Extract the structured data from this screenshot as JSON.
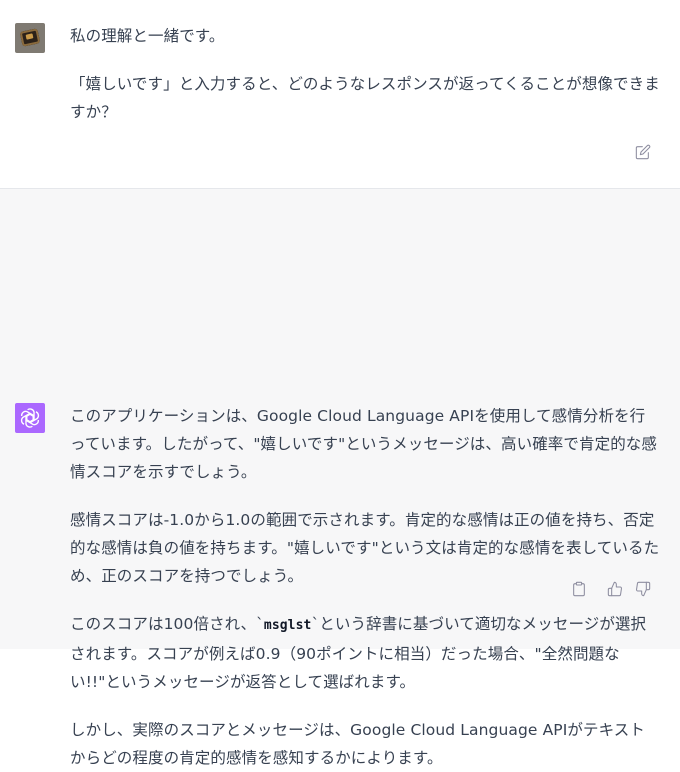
{
  "conversation": {
    "user_message": {
      "paragraphs": [
        "私の理解と一緒です。",
        "「嬉しいです」と入力すると、どのようなレスポンスが返ってくることが想像できますか？"
      ]
    },
    "assistant_message": {
      "p1": "このアプリケーションは、Google Cloud Language APIを使用して感情分析を行っています。したがって、\"嬉しいです\"というメッセージは、高い確率で肯定的な感情スコアを示すでしょう。",
      "p2": "感情スコアは-1.0から1.0の範囲で示されます。肯定的な感情は正の値を持ち、否定的な感情は負の値を持ちます。\"嬉しいです\"という文は肯定的な感情を表しているため、正のスコアを持つでしょう。",
      "p3_before": "このスコアは100倍され、`",
      "p3_code": "msglst",
      "p3_after": "`という辞書に基づいて適切なメッセージが選択されます。スコアが例えば0.9（90ポイントに相当）だった場合、\"全然問題ない!!\"というメッセージが返答として選ばれます。",
      "p4": "しかし、実際のスコアとメッセージは、Google Cloud Language APIがテキストからどの程度の肯定的感情を感知するかによります。"
    }
  },
  "icons": {
    "edit": "edit-icon",
    "copy": "clipboard-icon",
    "thumbs_up": "thumbs-up-icon",
    "thumbs_down": "thumbs-down-icon",
    "assistant_logo": "openai-logo-icon"
  },
  "colors": {
    "assistant_avatar": "#ab68ff",
    "assistant_bg": "#f7f7f8",
    "text": "#374151",
    "icon": "#8e8ea0"
  }
}
